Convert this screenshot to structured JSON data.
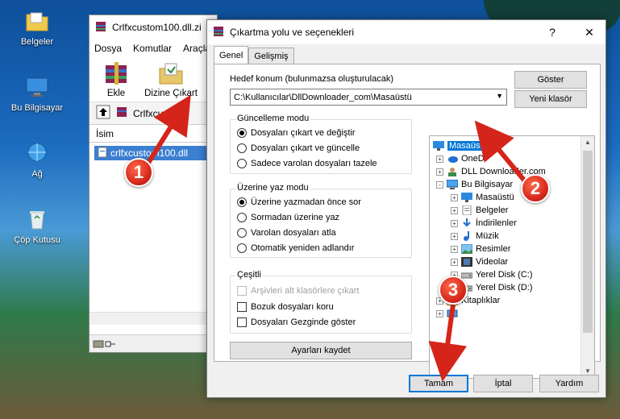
{
  "desktop": {
    "icons": [
      {
        "label": "Belgeler",
        "icon": "documents-folder-icon"
      },
      {
        "label": "Bu Bilgisayar",
        "icon": "computer-icon"
      },
      {
        "label": "Ağ",
        "icon": "network-icon"
      },
      {
        "label": "Çöp Kutusu",
        "icon": "recycle-bin-icon"
      }
    ]
  },
  "winrar": {
    "title": "Crlfxcustom100.dll.zi",
    "menu": [
      "Dosya",
      "Komutlar",
      "Araçla"
    ],
    "toolbar": {
      "extract_label": "Ekle",
      "extract_to_label": "Dizine Çıkart"
    },
    "path": "Crlfxcustom",
    "column_name": "İsim",
    "file": "crlfxcustom100.dll"
  },
  "dialog": {
    "title": "Çıkartma yolu ve seçenekleri",
    "help_label": "?",
    "close_label": "✕",
    "tabs": [
      "Genel",
      "Gelişmiş"
    ],
    "destination_label": "Hedef konum (bulunmazsa oluşturulacak)",
    "destination_value": "C:\\Kullanıcılar\\DllDownloader_com\\Masaüstü",
    "show_button": "Göster",
    "new_folder_button": "Yeni klasör",
    "update_mode": {
      "title": "Güncelleme modu",
      "options": [
        "Dosyaları çıkart ve değiştir",
        "Dosyaları çıkart ve güncelle",
        "Sadece varolan dosyaları tazele"
      ],
      "selected": 0
    },
    "overwrite_mode": {
      "title": "Üzerine yaz modu",
      "options": [
        "Üzerine yazmadan önce sor",
        "Sormadan üzerine yaz",
        "Varolan dosyaları atla",
        "Otomatik yeniden adlandır"
      ],
      "selected": 0
    },
    "misc": {
      "title": "Çeşitli",
      "options": [
        {
          "label": "Arşivleri alt klasörlere çıkart",
          "disabled": true,
          "checked": false
        },
        {
          "label": "Bozuk dosyaları koru",
          "disabled": false,
          "checked": false
        },
        {
          "label": "Dosyaları Gezginde göster",
          "disabled": false,
          "checked": false
        }
      ]
    },
    "save_settings_button": "Ayarları kaydet",
    "tree": [
      {
        "label": "Masaüstü",
        "depth": 0,
        "icon": "desktop-icon",
        "selected": true,
        "expander": ""
      },
      {
        "label": "OneD",
        "depth": 1,
        "icon": "onedrive-icon",
        "selected": false,
        "expander": "+"
      },
      {
        "label": "DLL Downloader.com",
        "depth": 1,
        "icon": "user-icon",
        "selected": false,
        "expander": "+"
      },
      {
        "label": "Bu Bilgisayar",
        "depth": 1,
        "icon": "computer-icon",
        "selected": false,
        "expander": "-"
      },
      {
        "label": "Masaüstü",
        "depth": 2,
        "icon": "desktop-icon",
        "selected": false,
        "expander": "+"
      },
      {
        "label": "Belgeler",
        "depth": 2,
        "icon": "documents-icon",
        "selected": false,
        "expander": "+"
      },
      {
        "label": "İndirilenler",
        "depth": 2,
        "icon": "downloads-icon",
        "selected": false,
        "expander": "+"
      },
      {
        "label": "Müzik",
        "depth": 2,
        "icon": "music-icon",
        "selected": false,
        "expander": "+"
      },
      {
        "label": "Resimler",
        "depth": 2,
        "icon": "pictures-icon",
        "selected": false,
        "expander": "+"
      },
      {
        "label": "Videolar",
        "depth": 2,
        "icon": "videos-icon",
        "selected": false,
        "expander": "+"
      },
      {
        "label": "Yerel Disk (C:)",
        "depth": 2,
        "icon": "drive-icon",
        "selected": false,
        "expander": "+"
      },
      {
        "label": "Yerel Disk (D:)",
        "depth": 2,
        "icon": "drive-icon",
        "selected": false,
        "expander": "+"
      },
      {
        "label": "Kitaplıklar",
        "depth": 1,
        "icon": "library-icon",
        "selected": false,
        "expander": "+"
      },
      {
        "label": "",
        "depth": 1,
        "icon": "network-icon",
        "selected": false,
        "expander": "+"
      }
    ],
    "ok_button": "Tamam",
    "cancel_button": "İptal",
    "help_button": "Yardım"
  },
  "annotations": [
    "1",
    "2",
    "3"
  ],
  "colors": {
    "accent": "#0078d7",
    "marker": "#d5251a",
    "selection": "#0078d7"
  }
}
